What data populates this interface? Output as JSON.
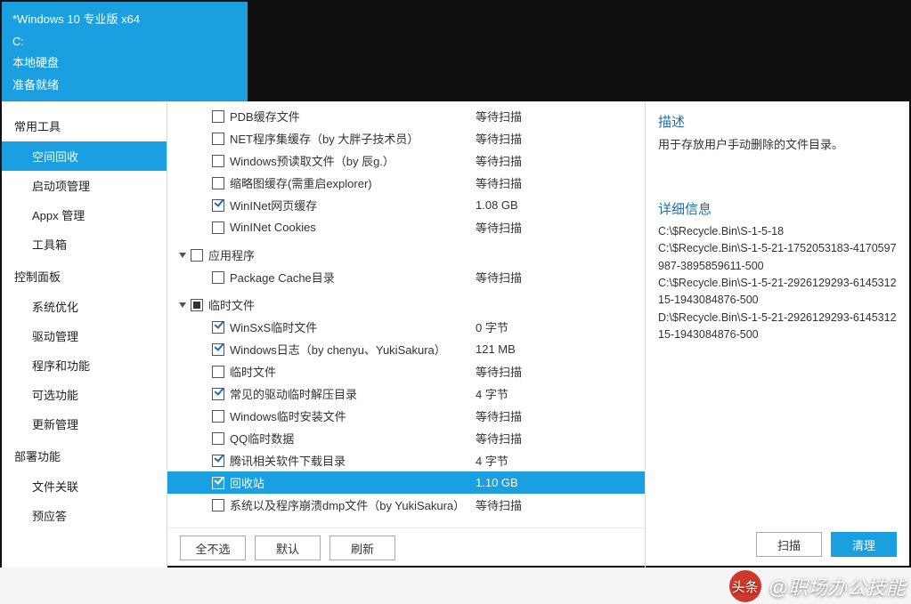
{
  "header": {
    "os_line": "*Windows 10 专业版 x64",
    "drive_line": "C:",
    "disk_type": "本地硬盘",
    "ready": "准备就绪"
  },
  "sidebar": {
    "sections": [
      {
        "title": "常用工具",
        "items": [
          {
            "label": "空间回收",
            "active": true
          },
          {
            "label": "启动项管理"
          },
          {
            "label": "Appx 管理"
          },
          {
            "label": "工具箱"
          }
        ]
      },
      {
        "title": "控制面板",
        "items": [
          {
            "label": "系统优化"
          },
          {
            "label": "驱动管理"
          },
          {
            "label": "程序和功能"
          },
          {
            "label": "可选功能"
          },
          {
            "label": "更新管理"
          }
        ]
      },
      {
        "title": "部署功能",
        "items": [
          {
            "label": "文件关联"
          },
          {
            "label": "预应答"
          }
        ]
      }
    ]
  },
  "scan": {
    "children_top": [
      {
        "label": "PDB缓存文件",
        "checked": false,
        "status": "等待扫描"
      },
      {
        "label": "NET程序集缓存（by 大胖子技术员）",
        "checked": false,
        "status": "等待扫描"
      },
      {
        "label": "Windows预读取文件（by 辰g.）",
        "checked": false,
        "status": "等待扫描"
      },
      {
        "label": "缩略图缓存(需重启explorer)",
        "checked": false,
        "status": "等待扫描"
      },
      {
        "label": "WinINet网页缓存",
        "checked": true,
        "status": "1.08 GB"
      },
      {
        "label": "WinINet Cookies",
        "checked": false,
        "status": "等待扫描"
      }
    ],
    "group_app": {
      "label": "应用程序",
      "state": "unchecked"
    },
    "children_app": [
      {
        "label": "Package Cache目录",
        "checked": false,
        "status": "等待扫描"
      }
    ],
    "group_temp": {
      "label": "临时文件",
      "state": "partial"
    },
    "children_temp": [
      {
        "label": "WinSxS临时文件",
        "checked": true,
        "status": "0 字节"
      },
      {
        "label": "Windows日志（by chenyu、YukiSakura）",
        "checked": true,
        "status": "121 MB"
      },
      {
        "label": "临时文件",
        "checked": false,
        "status": "等待扫描"
      },
      {
        "label": "常见的驱动临时解压目录",
        "checked": true,
        "status": "4 字节"
      },
      {
        "label": "Windows临时安装文件",
        "checked": false,
        "status": "等待扫描"
      },
      {
        "label": "QQ临时数据",
        "checked": false,
        "status": "等待扫描"
      },
      {
        "label": "腾讯相关软件下载目录",
        "checked": true,
        "status": "4 字节"
      },
      {
        "label": "回收站",
        "checked": true,
        "status": "1.10 GB",
        "selected": true
      },
      {
        "label": "系统以及程序崩溃dmp文件（by YukiSakura）",
        "checked": false,
        "status": "等待扫描"
      }
    ]
  },
  "buttons": {
    "deselect_all": "全不选",
    "default": "默认",
    "refresh": "刷新",
    "scan": "扫描",
    "clean": "清理"
  },
  "desc": {
    "title": "描述",
    "text": "用于存放用户手动删除的文件目录。"
  },
  "details": {
    "title": "详细信息",
    "lines": [
      "C:\\$Recycle.Bin\\S-1-5-18",
      "C:\\$Recycle.Bin\\S-1-5-21-1752053183-4170597987-3895859611-500",
      "C:\\$Recycle.Bin\\S-1-5-21-2926129293-614531215-1943084876-500",
      "D:\\$Recycle.Bin\\S-1-5-21-2926129293-614531215-1943084876-500"
    ]
  },
  "watermark": {
    "logo_text": "头条",
    "author": "@职场办公技能"
  }
}
